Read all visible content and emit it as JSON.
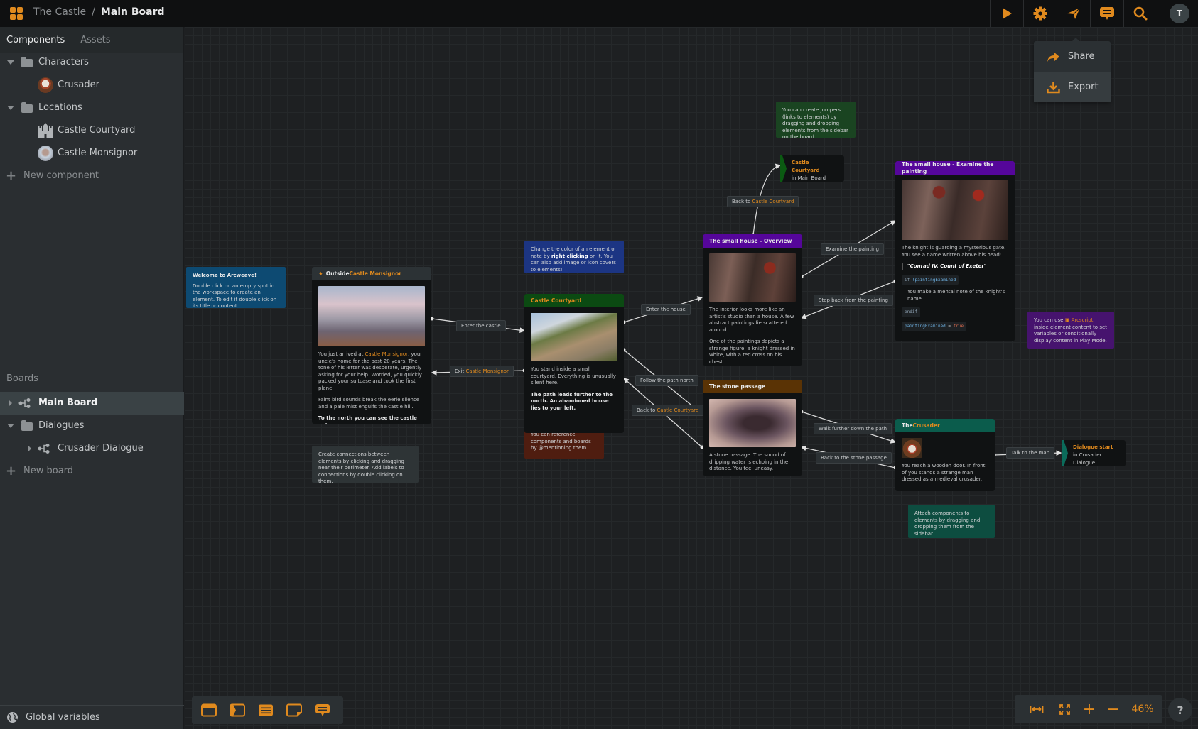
{
  "header": {
    "project": "The Castle",
    "separator": "/",
    "board": "Main Board",
    "buttons": [
      "play",
      "settings",
      "share",
      "comments",
      "search"
    ],
    "user_initial": "T",
    "accent": "#e08a1e"
  },
  "share_menu": {
    "items": [
      {
        "label": "Share",
        "icon": "share-arrow-icon"
      },
      {
        "label": "Export",
        "icon": "download-icon"
      }
    ]
  },
  "sidebar": {
    "tabs": [
      {
        "label": "Components",
        "active": true
      },
      {
        "label": "Assets",
        "active": false
      }
    ],
    "components": [
      {
        "type": "folder",
        "label": "Characters",
        "expanded": true
      },
      {
        "type": "component",
        "label": "Crusader"
      },
      {
        "type": "folder",
        "label": "Locations",
        "expanded": true
      },
      {
        "type": "component",
        "label": "Castle Courtyard"
      },
      {
        "type": "component",
        "label": "Castle Monsignor"
      }
    ],
    "new_component": "New component",
    "boards_heading": "Boards",
    "boards": [
      {
        "type": "board",
        "label": "Main Board",
        "selected": true
      },
      {
        "type": "folder",
        "label": "Dialogues",
        "expanded": true
      },
      {
        "type": "board",
        "label": "Crusader Dialogue"
      }
    ],
    "new_board": "New board",
    "global_variables": "Global variables"
  },
  "notes": {
    "welcome": {
      "title": "Welcome to Arcweave!",
      "text": "Double click on an empty spot in the workspace to create an element. To edit it double click on its title or content.",
      "color": "#0d4a72"
    },
    "color_tip": {
      "pre": "Change the color of an element or note by ",
      "bold": "right clicking",
      "post": " on it. You can also add image or icon covers to elements!",
      "color": "#1c3583"
    },
    "jumper_tip": {
      "text": "You can create jumpers (links to elements) by dragging and dropping elements from the sidebar on the board.",
      "color": "#1a4421"
    },
    "reference_tip": {
      "text": "You can reference components and boards by @mentioning them.",
      "color": "#4f1d10"
    },
    "connections_tip": {
      "text": "Create connections between elements by clicking and dragging near their perimeter. Add labels to connections by double clicking on them.",
      "color": "#2e3436"
    },
    "arcscript_tip": {
      "pre": "You can use ",
      "link": "Arcscript",
      "post": " inside element content to set variables or conditionally display content in Play Mode.",
      "color": "#46136e"
    },
    "attach_tip": {
      "text": "Attach components to elements by dragging and dropping them from the sidebar.",
      "color": "#0d4d40"
    }
  },
  "elements": {
    "outside": {
      "title_pre": "Outside ",
      "title_link": "Castle Monsignor",
      "header_color": "#2c3235",
      "p1_pre": "You just arrived at ",
      "p1_link": "Castle Monsignor",
      "p1_post": ", your uncle's home for the past 20 years. The tone of his letter was desperate, urgently asking for your help. Worried, you quickly packed your suitcase and took the first plane.",
      "p2": "Faint bird sounds break the eerie silence and a pale mist engulfs the castle hill.",
      "p3": "To the north you can see the castle entrance."
    },
    "courtyard": {
      "title": "Castle Courtyard",
      "header_color": "#0b4a12",
      "p1": "You stand inside a small courtyard. Everything is unusually silent here.",
      "p2": "The path leads further to the north. An abandoned house lies to your left."
    },
    "house_overview": {
      "title": "The small house - Overview",
      "header_color": "#55069a",
      "p1": "The interior looks more like an artist's studio than a house. A few abstract paintings lie scattered around.",
      "p2": "One of the paintings depicts a strange figure: a knight dressed in white, with a red cross on his chest."
    },
    "house_painting": {
      "title": "The small house - Examine the painting",
      "header_color": "#55069a",
      "p1": "The knight is guarding a mysterious gate. You see a name written above his head:",
      "quote": "\"Conrad IV, Count of Exeter\"",
      "code_if_kw": "if",
      "code_if_var": "!paintingExamined",
      "p2": "You make a mental note of the knight's name.",
      "code_endif": "endif",
      "code_assign_var": "paintingExamined",
      "code_assign_op": "=",
      "code_assign_val": "true"
    },
    "stone_passage": {
      "title": "The stone passage",
      "header_color": "#5a3305",
      "p1": "A stone passage. The sound of dripping water is echoing in the distance. You feel uneasy."
    },
    "crusader": {
      "title_pre": "The ",
      "title_link": "Crusader",
      "header_color": "#0b5c4c",
      "p1": "You reach a wooden door. In front of you stands a strange man dressed as a medieval crusader."
    }
  },
  "jumpers": {
    "courtyard_jumper": {
      "title": "Castle Courtyard",
      "sub": "in Main Board",
      "flag_color": "#0b5a12"
    },
    "dialogue_jumper": {
      "title": "Dialogue start",
      "sub": "in Crusader Dialogue",
      "flag_color": "#0b6b5a"
    }
  },
  "connection_labels": {
    "enter_castle": "Enter the castle",
    "exit_pre": "Exit ",
    "exit_link": "Castle Monsignor",
    "enter_house": "Enter the house",
    "follow_path": "Follow the path north",
    "back_pre": "Back to ",
    "back_link": "Castle Courtyard",
    "back2_pre": "Back to ",
    "back2_link": "Castle Courtyard",
    "examine": "Examine the painting",
    "step_back": "Step back from the painting",
    "walk_further": "Walk further down the path",
    "back_stone": "Back to the stone passage",
    "talk": "Talk to the man"
  },
  "bottom_tools": [
    "element-tool",
    "jumper-tool",
    "branch-tool",
    "note-tool",
    "comment-tool"
  ],
  "zoom_controls": {
    "zoom_level": "46%",
    "help": "?"
  }
}
